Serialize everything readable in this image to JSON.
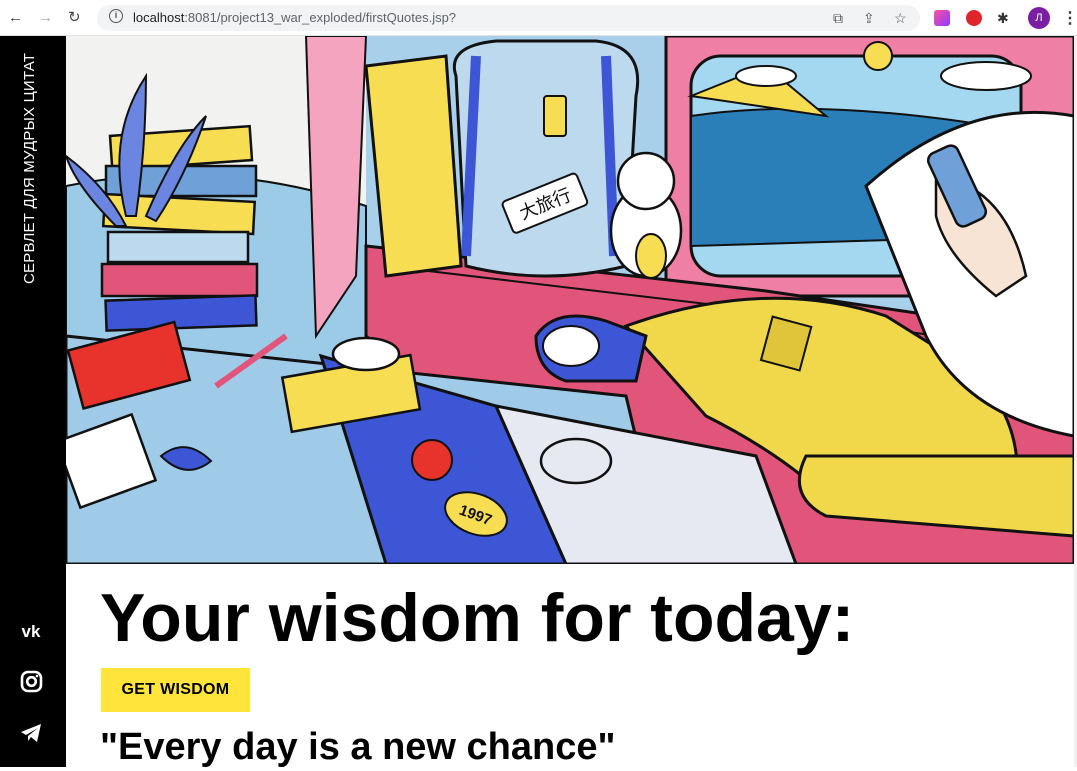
{
  "browser": {
    "url_host": "localhost",
    "url_rest": ":8081/project13_war_exploded/firstQuotes.jsp?",
    "profile_initial": "Л"
  },
  "sidebar": {
    "title": "СЕРВЛЕТ ДЛЯ МУДРЫХ ЦИТАТ",
    "social": [
      {
        "icon": "vk-icon"
      },
      {
        "icon": "instagram-icon"
      },
      {
        "icon": "telegram-icon"
      }
    ]
  },
  "hero": {
    "laptop_sticker": "1997",
    "bag_tag": "大旅行"
  },
  "main": {
    "heading": "Your wisdom for today:",
    "button_label": "GET WISDOM",
    "quote": "\"Every day is a new chance\""
  },
  "colors": {
    "accent_yellow": "#ffe53b",
    "sidebar_bg": "#000000"
  }
}
